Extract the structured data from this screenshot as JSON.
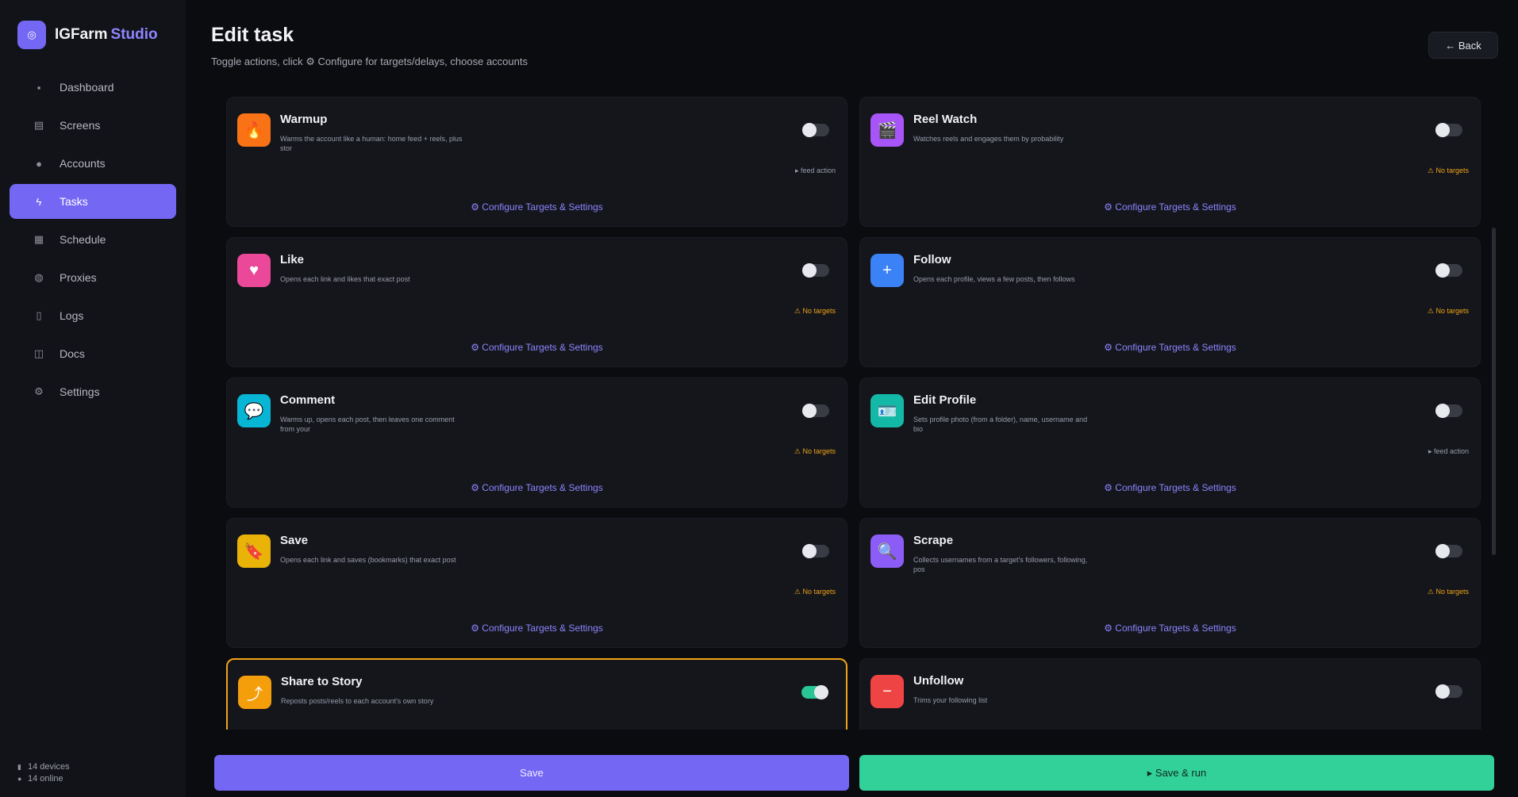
{
  "brand": {
    "name": "IGFarm",
    "accent": "Studio"
  },
  "nav": [
    {
      "label": "Dashboard",
      "icon": "dashboard-icon",
      "glyph": "▪"
    },
    {
      "label": "Screens",
      "icon": "screens-icon",
      "glyph": "▤"
    },
    {
      "label": "Accounts",
      "icon": "user-icon",
      "glyph": "●"
    },
    {
      "label": "Tasks",
      "icon": "bolt-icon",
      "glyph": "ϟ"
    },
    {
      "label": "Schedule",
      "icon": "calendar-icon",
      "glyph": "▦"
    },
    {
      "label": "Proxies",
      "icon": "globe-icon",
      "glyph": "◍"
    },
    {
      "label": "Logs",
      "icon": "document-icon",
      "glyph": "▯"
    },
    {
      "label": "Docs",
      "icon": "book-icon",
      "glyph": "◫"
    },
    {
      "label": "Settings",
      "icon": "gear-icon",
      "glyph": "⚙"
    }
  ],
  "status": {
    "devices": "14 devices",
    "online": "14 online"
  },
  "header": {
    "title": "Edit task",
    "subtitle": "Toggle actions, click ⚙ Configure for targets/delays, choose accounts",
    "back": "← Back"
  },
  "cards": [
    {
      "title": "Warmup",
      "desc": "Warms the account like a human: home feed + reels, plus stor",
      "status": "▸ feed action",
      "warn": false,
      "config": "⚙ Configure Targets & Settings",
      "color": "#f97316",
      "glyph": "🔥",
      "icon": "flame-icon",
      "enabled": false
    },
    {
      "title": "Reel Watch",
      "desc": "Watches reels and engages them by probability",
      "status": "⚠ No targets",
      "warn": true,
      "config": "⚙ Configure Targets & Settings",
      "color": "#a855f7",
      "glyph": "🎬",
      "icon": "clapper-icon",
      "enabled": false
    },
    {
      "title": "Like",
      "desc": "Opens each link and likes that exact post",
      "status": "⚠ No targets",
      "warn": true,
      "config": "⚙ Configure Targets & Settings",
      "color": "#ec4899",
      "glyph": "♥",
      "icon": "heart-icon",
      "enabled": false
    },
    {
      "title": "Follow",
      "desc": "Opens each profile, views a few posts, then follows",
      "status": "⚠ No targets",
      "warn": true,
      "config": "⚙ Configure Targets & Settings",
      "color": "#3b82f6",
      "glyph": "+",
      "icon": "plus-icon",
      "enabled": false
    },
    {
      "title": "Comment",
      "desc": "Warms up, opens each post, then leaves one comment from your",
      "status": "⚠ No targets",
      "warn": true,
      "config": "⚙ Configure Targets & Settings",
      "color": "#06b6d4",
      "glyph": "💬",
      "icon": "speech-bubble-icon",
      "enabled": false
    },
    {
      "title": "Edit Profile",
      "desc": "Sets profile photo (from a folder), name, username and bio",
      "status": "▸ feed action",
      "warn": false,
      "config": "⚙ Configure Targets & Settings",
      "color": "#14b8a6",
      "glyph": "🪪",
      "icon": "id-card-icon",
      "enabled": false
    },
    {
      "title": "Save",
      "desc": "Opens each link and saves (bookmarks) that exact post",
      "status": "⚠ No targets",
      "warn": true,
      "config": "⚙ Configure Targets & Settings",
      "color": "#eab308",
      "glyph": "🔖",
      "icon": "bookmark-icon",
      "enabled": false
    },
    {
      "title": "Scrape",
      "desc": "Collects usernames from a target's followers, following, pos",
      "status": "⚠ No targets",
      "warn": true,
      "config": "⚙ Configure Targets & Settings",
      "color": "#8b5cf6",
      "glyph": "🔍",
      "icon": "magnifier-icon",
      "enabled": false
    },
    {
      "title": "Share to Story",
      "desc": "Reposts posts/reels to each account's own story",
      "status": "",
      "warn": false,
      "config": "",
      "color": "#f59e0b",
      "glyph": "⤴",
      "icon": "share-icon",
      "enabled": true,
      "selected": true
    },
    {
      "title": "Unfollow",
      "desc": "Trims your following list",
      "status": "",
      "warn": false,
      "config": "",
      "color": "#ef4444",
      "glyph": "−",
      "icon": "minus-icon",
      "enabled": false
    }
  ],
  "footer": {
    "save": "Save",
    "run": "▸ Save & run"
  }
}
